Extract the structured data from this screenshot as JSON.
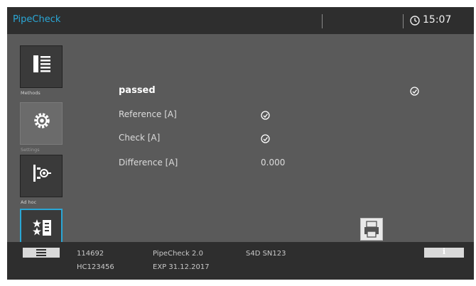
{
  "header": {
    "app_title": "PipeCheck",
    "clock": "15:07",
    "clock_icon": "clock-icon"
  },
  "sidebar": {
    "items": [
      {
        "label": "Methods",
        "icon": "list-document-icon"
      },
      {
        "label": "Settings",
        "icon": "gear-icon"
      },
      {
        "label": "Ad hoc",
        "icon": "measurement-icon"
      },
      {
        "label": "",
        "icon": "favorites-icon"
      }
    ]
  },
  "result": {
    "status": "passed",
    "status_icon": "clock-check-icon",
    "rows": [
      {
        "label": "Reference [A]",
        "value": "",
        "value_icon": "clock-check-icon"
      },
      {
        "label": "Check [A]",
        "value": "",
        "value_icon": "clock-check-icon"
      },
      {
        "label": "Difference [A]",
        "value": "0.000"
      }
    ],
    "print_icon": "printer-icon"
  },
  "footer": {
    "menu_icon": "hamburger-icon",
    "id1": "114692",
    "id2": "HC123456",
    "product": "PipeCheck 2.0",
    "expiry": "EXP 31.12.2017",
    "device": "S4D SN123",
    "info_label": "i"
  },
  "colors": {
    "accent": "#2aa7d6",
    "background": "#5a5a5a",
    "bar": "#2e2e2e"
  }
}
